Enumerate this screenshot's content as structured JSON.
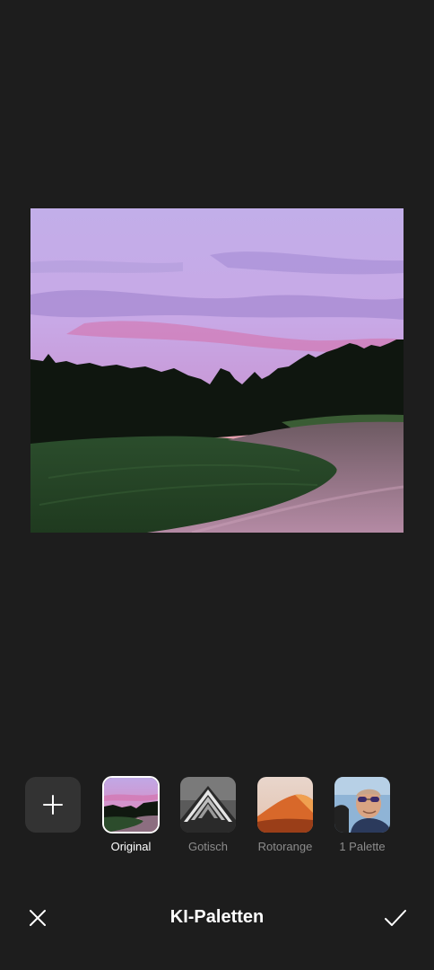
{
  "editor": {
    "title": "KI-Paletten",
    "close_icon": "close-icon",
    "confirm_icon": "checkmark-icon"
  },
  "palettes": {
    "add_icon": "plus-icon",
    "items": [
      {
        "label": "Original",
        "selected": true,
        "icon": "sunset-landscape-thumbnail"
      },
      {
        "label": "Gotisch",
        "selected": false,
        "icon": "gothic-architecture-thumbnail"
      },
      {
        "label": "Rotorange",
        "selected": false,
        "icon": "orange-dune-thumbnail"
      },
      {
        "label": "1 Palette",
        "selected": false,
        "icon": "portrait-thumbnail"
      }
    ]
  },
  "colors": {
    "background": "#1d1d1d",
    "add_button": "#333333",
    "label_inactive": "#8c8c8c",
    "label_active": "#ffffff"
  }
}
